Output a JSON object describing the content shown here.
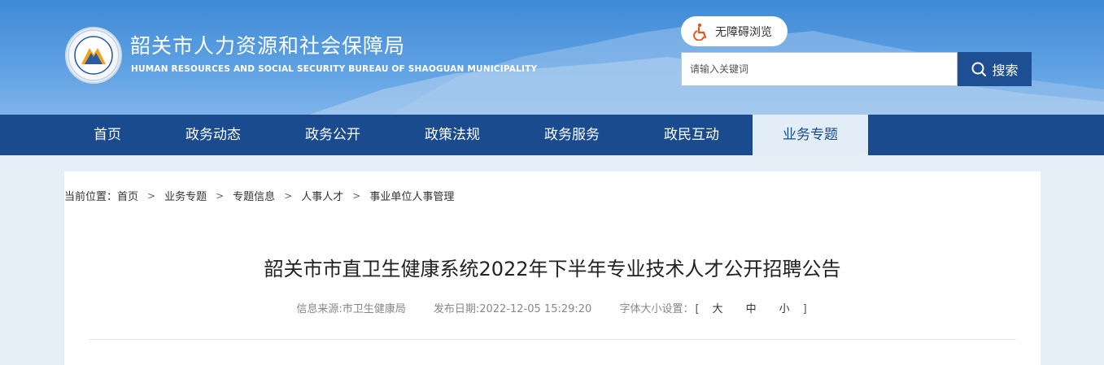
{
  "header": {
    "org_name_cn": "韶关市人力资源和社会保障局",
    "org_name_en": "HUMAN RESOURCES AND SOCIAL SECURITY BUREAU OF SHAOGUAN MUNICIPALITY",
    "accessibility_label": "无障碍浏览",
    "search_placeholder": "请输入关键词",
    "search_button": "搜索"
  },
  "nav": {
    "items": [
      "首页",
      "政务动态",
      "政务公开",
      "政策法规",
      "政务服务",
      "政民互动",
      "业务专题"
    ],
    "active_index": 6
  },
  "breadcrumb": {
    "prefix": "当前位置：",
    "items": [
      "首页",
      "业务专题",
      "专题信息",
      "人事人才",
      "事业单位人事管理"
    ],
    "separator": ">"
  },
  "article": {
    "title": "韶关市市直卫生健康系统2022年下半年专业技术人才公开招聘公告",
    "source": "信息来源:市卫生健康局",
    "date": "发布日期:2022-12-05 15:29:20",
    "font_size_label": "字体大小设置：",
    "font_size_options": [
      "大",
      "中",
      "小"
    ],
    "bracket_open": "[",
    "bracket_close": "]"
  },
  "colors": {
    "nav_bg": "#1a4b8e",
    "search_button_bg": "#1e4f92",
    "header_bg": "#4a92dc",
    "page_bg": "#e6eef8"
  }
}
